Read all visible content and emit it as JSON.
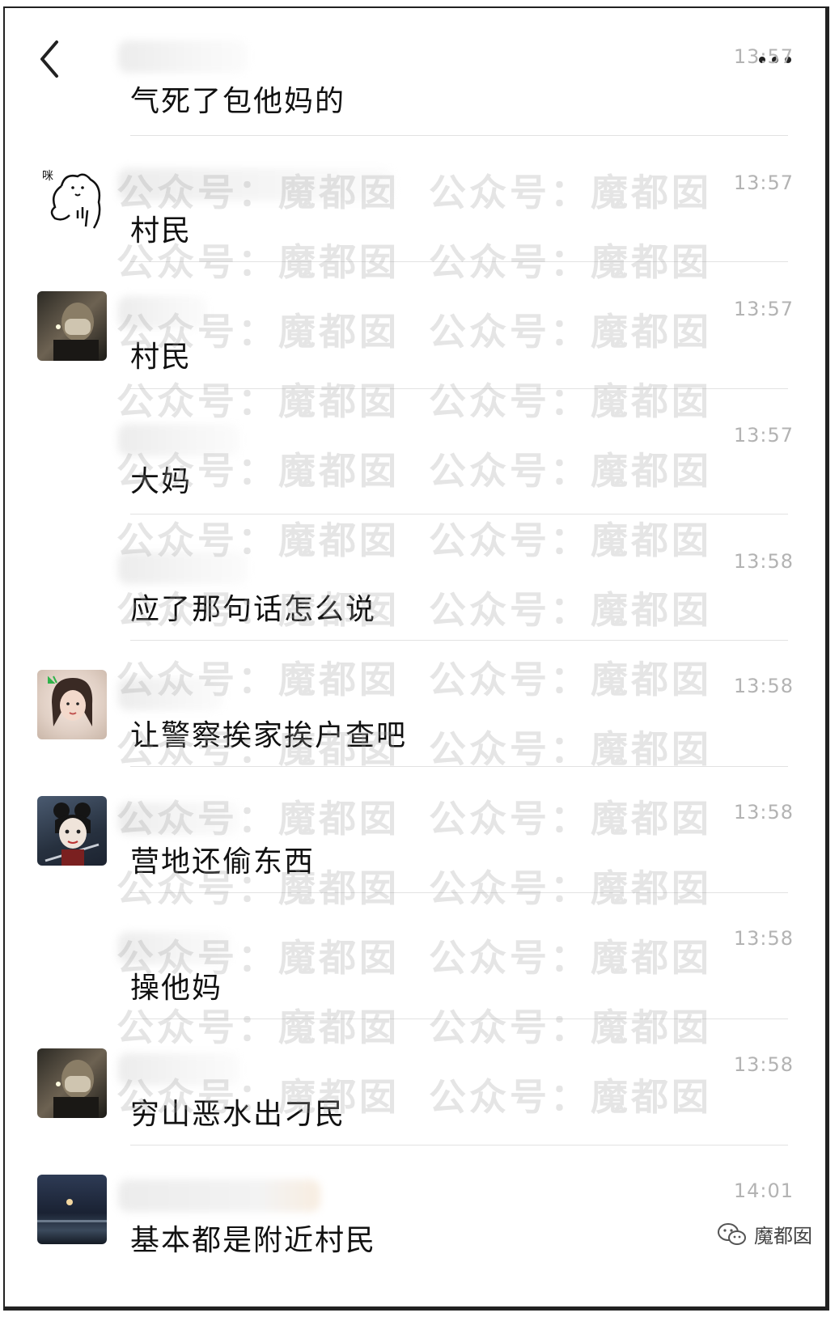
{
  "watermark": "公众号：魔都囡",
  "brand_label": "魔都囡",
  "messages": [
    {
      "text": "气死了包他妈的",
      "time": "13:57",
      "avatar": "none"
    },
    {
      "text": "村民",
      "time": "13:57",
      "avatar": "doodle-bear"
    },
    {
      "text": "村民",
      "time": "13:57",
      "avatar": "masked-person"
    },
    {
      "text": "大妈",
      "time": "13:57",
      "avatar": "none"
    },
    {
      "text": "应了那句话怎么说",
      "time": "13:58",
      "avatar": "none"
    },
    {
      "text": "让警察挨家挨户查吧",
      "time": "13:58",
      "avatar": "girl-portrait"
    },
    {
      "text": "营地还偷东西",
      "time": "13:58",
      "avatar": "anime-warrior"
    },
    {
      "text": "操他妈",
      "time": "13:58",
      "avatar": "none"
    },
    {
      "text": "穷山恶水出刁民",
      "time": "13:58",
      "avatar": "masked-person"
    },
    {
      "text": "基本都是附近村民",
      "time": "14:01",
      "avatar": "night-sea"
    }
  ]
}
